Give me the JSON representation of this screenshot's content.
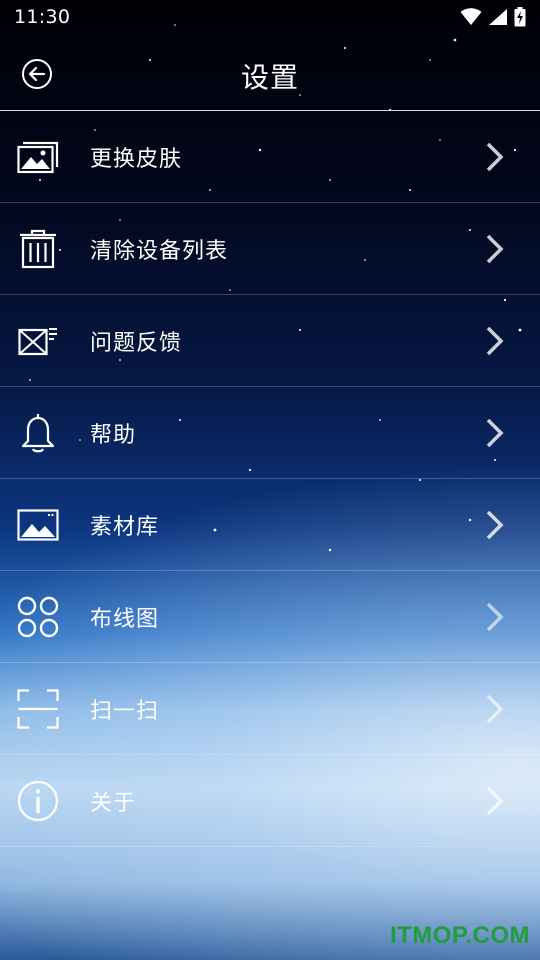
{
  "status_bar": {
    "time": "11:30",
    "icons": [
      "wifi-icon",
      "signal-icon",
      "battery-charging-icon"
    ]
  },
  "header": {
    "title": "设置",
    "back_icon": "back-arrow-icon"
  },
  "menu": {
    "items": [
      {
        "label": "更换皮肤",
        "icon": "gallery-icon"
      },
      {
        "label": "清除设备列表",
        "icon": "trash-icon"
      },
      {
        "label": "问题反馈",
        "icon": "mail-icon"
      },
      {
        "label": "帮助",
        "icon": "bell-icon"
      },
      {
        "label": "素材库",
        "icon": "image-icon"
      },
      {
        "label": "布线图",
        "icon": "circles-grid-icon"
      },
      {
        "label": "扫一扫",
        "icon": "scan-icon"
      },
      {
        "label": "关于",
        "icon": "info-icon"
      }
    ]
  },
  "watermark": "ITMOP.COM",
  "colors": {
    "text": "#ffffff",
    "watermark": "#1f9e3c"
  }
}
